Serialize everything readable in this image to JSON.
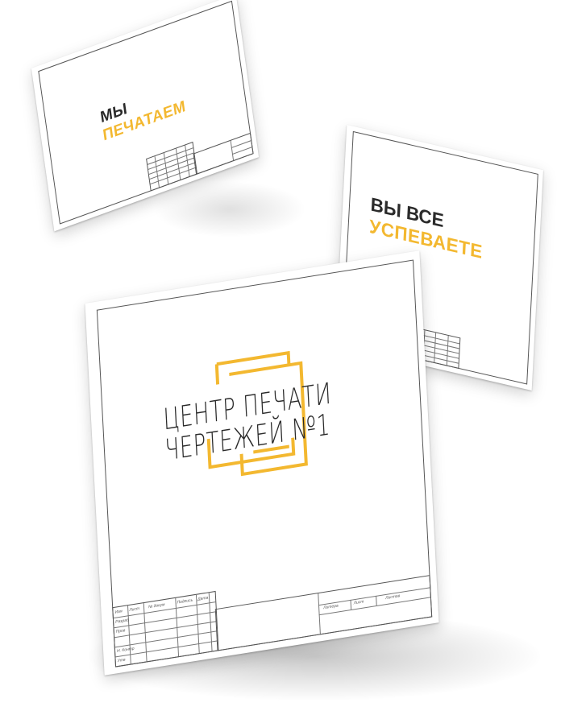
{
  "sheets": {
    "sheet1": {
      "line1": "МЫ",
      "line2": "ПЕЧАТАЕМ"
    },
    "sheet2": {
      "line1": "ВЫ ВСЕ",
      "line2": "УСПЕВАЕТЕ"
    },
    "main": {
      "logo_line1": "ЦЕНТР ПЕЧАТИ",
      "logo_line2": "ЧЕРТЕЖЕЙ №1",
      "stamp_left_labels": [
        "Изм",
        "Лист",
        "№ докум",
        "Подпись",
        "Дата",
        "Разраб",
        "Пров",
        "Н. Контр",
        "Утв"
      ],
      "stamp_right_labels": [
        "Литера",
        "Лист",
        "Листов"
      ]
    }
  },
  "colors": {
    "accent": "#f3b830",
    "text": "#2b2b2b",
    "line": "#555555"
  }
}
